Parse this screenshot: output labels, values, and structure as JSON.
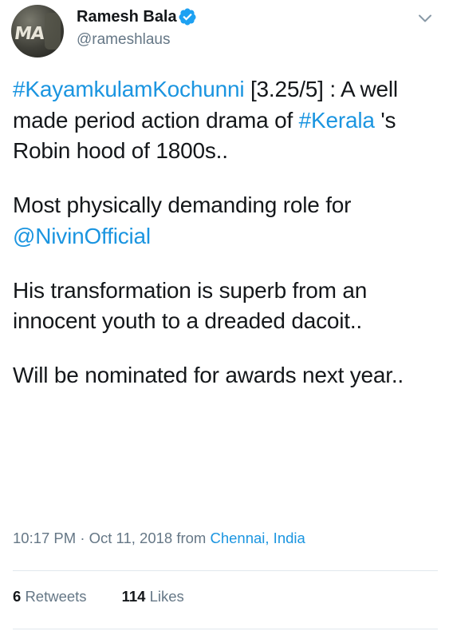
{
  "tweet": {
    "author": {
      "name": "Ramesh Bala",
      "handle": "@rameshlaus",
      "verified": true,
      "avatar_text": "MA"
    },
    "body": {
      "p1_tag1": "#KayamkulamKochunni",
      "p1_text1": " [3.25/5] : A well made period action drama of ",
      "p1_tag2": "#Kerala",
      "p1_text2": " 's Robin hood of 1800s..",
      "p2_text": "Most physically demanding role for ",
      "p2_mention": "@NivinOfficial",
      "p3_text": "His transformation is superb from an innocent youth to a dreaded dacoit..",
      "p4_text": "Will be nominated for awards next year.."
    },
    "meta": {
      "time": "10:17 PM",
      "separator": " · ",
      "date": "Oct 11, 2018",
      "from_label": " from ",
      "location": "Chennai, India"
    },
    "stats": {
      "retweets_count": "6",
      "retweets_label": "Retweets",
      "likes_count": "114",
      "likes_label": "Likes"
    }
  },
  "colors": {
    "link": "#1b95e0",
    "secondary_text": "#657786",
    "primary_text": "#14171a",
    "divider": "#e1e8ed"
  },
  "icons": {
    "verified": "verified-badge-icon",
    "menu": "chevron-down-icon"
  }
}
